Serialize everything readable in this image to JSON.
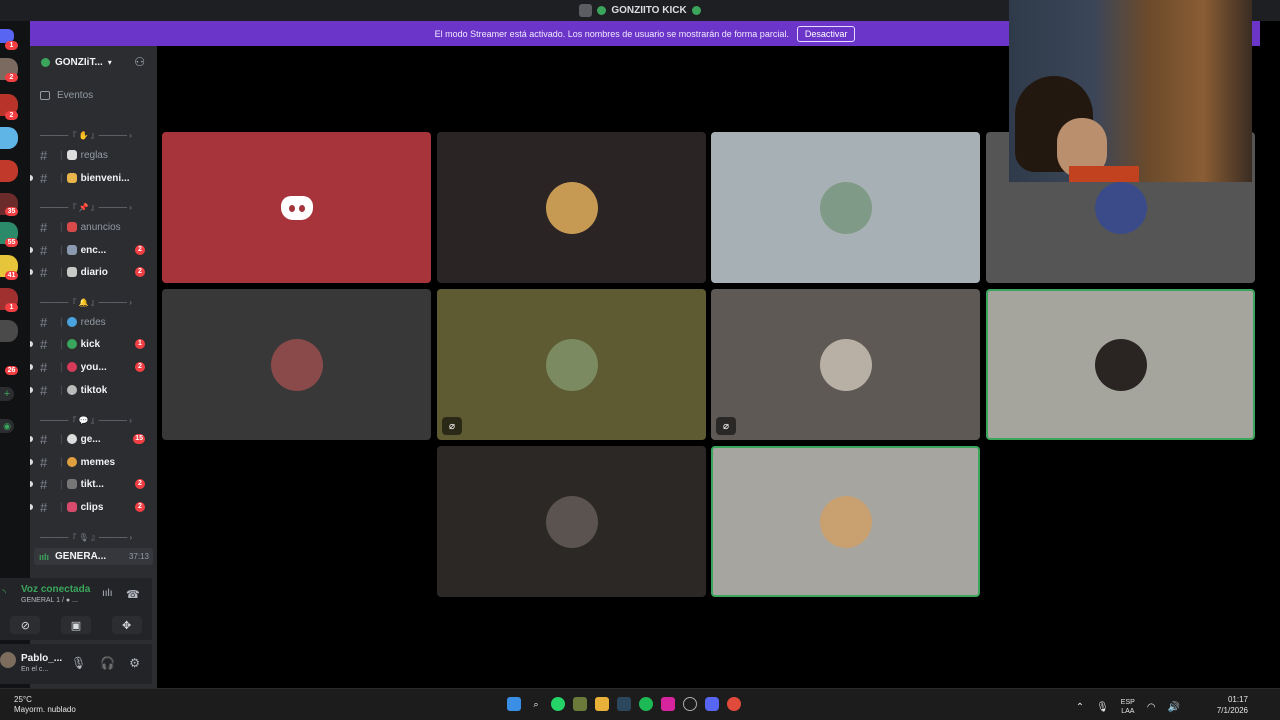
{
  "window": {
    "title": "GONZIITO KICK"
  },
  "banner": {
    "message": "El modo Streamer está activado. Los nombres de usuario se mostrarán de forma parcial.",
    "button": "Desactivar"
  },
  "server_badges": [
    "1",
    "2",
    "2",
    "35",
    "55",
    "41",
    "1",
    "26"
  ],
  "guild": {
    "name": "GONZIiT..."
  },
  "events_label": "Eventos",
  "channels": [
    {
      "name": "reglas",
      "badge": ""
    },
    {
      "name": "bienveni...",
      "badge": ""
    },
    {
      "name": "anuncios",
      "badge": ""
    },
    {
      "name": "enc...",
      "badge": "2"
    },
    {
      "name": "diario",
      "badge": "2"
    },
    {
      "name": "redes",
      "badge": ""
    },
    {
      "name": "kick",
      "badge": "1"
    },
    {
      "name": "you...",
      "badge": "2"
    },
    {
      "name": "tiktok",
      "badge": ""
    },
    {
      "name": "ge...",
      "badge": "15"
    },
    {
      "name": "memes",
      "badge": ""
    },
    {
      "name": "tikt...",
      "badge": "2"
    },
    {
      "name": "clips",
      "badge": "2"
    }
  ],
  "voice_channel": {
    "name": "GENERA...",
    "time": "37:13"
  },
  "voice_panel": {
    "title": "Voz conectada",
    "subtitle": "GENERAL 1 / ● ..."
  },
  "user": {
    "name": "Pablo_...",
    "status": "En el c..."
  },
  "tiles_colors": [
    "#a8343b",
    "#2b2424",
    "#a6b0b5",
    "#565555",
    "#383838",
    "#5e5b33",
    "#5e5955",
    "#a5a49d",
    "#2b2826",
    "#a6a5a0"
  ],
  "taskbar": {
    "weather_temp": "25°C",
    "weather_desc": "Mayorm. nublado",
    "lang_top": "ESP",
    "lang_bottom": "LAA",
    "time": "01:17",
    "date": "7/1/2026"
  }
}
